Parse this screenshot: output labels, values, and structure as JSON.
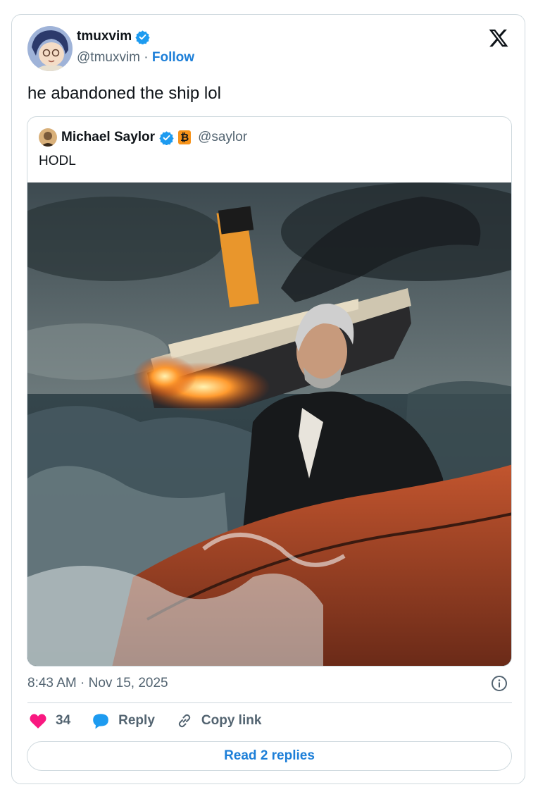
{
  "tweet": {
    "display_name": "tmuxvim",
    "handle": "@tmuxvim",
    "separator": "·",
    "follow_label": "Follow",
    "text": "he abandoned the ship lol",
    "timestamp": "8:43 AM · Nov 15, 2025"
  },
  "quote": {
    "display_name": "Michael Saylor",
    "handle": "@saylor",
    "text": "HODL",
    "btc_symbol": "₿"
  },
  "actions": {
    "like_count": "34",
    "reply_label": "Reply",
    "copy_label": "Copy link"
  },
  "footer": {
    "read_replies_label": "Read 2 replies"
  },
  "colors": {
    "link_blue": "#1d7fd8",
    "verified_blue": "#1d9bf0",
    "heart_pink": "#f91880",
    "text_secondary": "#536471",
    "border": "#cfd9de"
  },
  "icons": [
    "verified-badge-icon",
    "x-logo-icon",
    "bitcoin-badge-icon",
    "info-icon",
    "heart-icon",
    "reply-bubble-icon",
    "link-icon"
  ]
}
